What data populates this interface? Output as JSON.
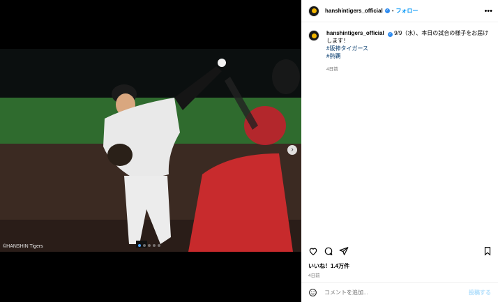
{
  "media": {
    "credit": "©HANSHIN Tigers",
    "next_icon": "chevron-right-icon",
    "dot_count": 5,
    "active_dot": 0
  },
  "header": {
    "username": "hanshintigers_official",
    "separator": "•",
    "follow_label": "フォロー",
    "more_icon": "more-horizontal-icon"
  },
  "caption": {
    "username": "hanshintigers_official",
    "text": "9/9（水）、本日の試合の様子をお届けします！",
    "hashtags": [
      "#阪神タイガース",
      "#熱覇"
    ],
    "time": "4日前"
  },
  "actions": {
    "icons": [
      "heart-icon",
      "comment-icon",
      "share-icon",
      "bookmark-icon"
    ]
  },
  "likes": "いいね！1.4万件",
  "date": "4日前",
  "comment": {
    "placeholder": "コメントを追加...",
    "post_label": "投稿する"
  },
  "colors": {
    "accent": "#0095f6",
    "verified": "#2f8cf0",
    "hashtag": "#00376b"
  }
}
